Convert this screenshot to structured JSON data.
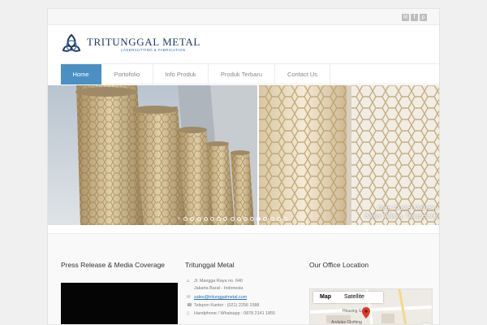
{
  "social": [
    {
      "icon": "mail-icon",
      "glyph": "✉"
    },
    {
      "icon": "facebook-icon",
      "glyph": "f"
    },
    {
      "icon": "pinterest-icon",
      "glyph": "p"
    }
  ],
  "brand": {
    "name": "TRITUNGGAL METAL",
    "tagline": "Lasercutting & Fabrication",
    "color": "#1f3a63"
  },
  "nav": {
    "items": [
      {
        "label": "Home",
        "active": true
      },
      {
        "label": "Portofolio",
        "active": false
      },
      {
        "label": "Info Produk",
        "active": false
      },
      {
        "label": "Produk Terbaru",
        "active": false
      },
      {
        "label": "Contact Us",
        "active": false
      }
    ],
    "accent": "#4a90c4"
  },
  "slider": {
    "caption_line1": "Gate Cluster Malberry",
    "caption_line2": "Banjar Wijaya, Tanggerang",
    "slide_count": 16,
    "active_slide": 11,
    "prev_icon": "chevron-left-icon",
    "next_icon": "chevron-right-icon"
  },
  "footer": {
    "press_title": "Press Release & Media Coverage",
    "company_title": "Tritunggal Metal",
    "office_title": "Our Office Location",
    "address_line1": "Jl. Mangga Raya no. 640",
    "address_line2": "Jakarta Barat - Indonesia",
    "email": "sales@tritunggalmetal.com",
    "phone": "Telepon Kantor : (021) 2256 1588",
    "mobile": "Handphone / Whatsapp : 0878 2141 1855"
  },
  "map": {
    "tab_map": "Map",
    "tab_satellite": "Satellite",
    "label_housing": "Housing Green",
    "label_clothing": "Andalas Clothing",
    "pin_color": "#e0392b"
  }
}
